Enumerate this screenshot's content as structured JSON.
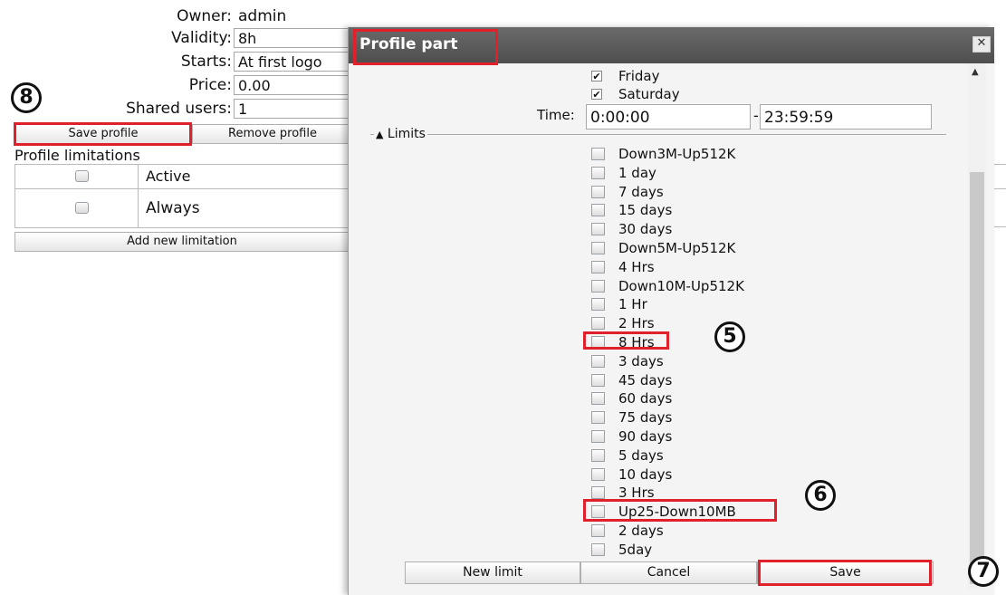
{
  "form": {
    "owner_label": "Owner:",
    "owner_value": "admin",
    "validity_label": "Validity:",
    "validity_value": "8h",
    "starts_label": "Starts:",
    "starts_value": "At first logo",
    "price_label": "Price:",
    "price_value": "0.00",
    "shared_label": "Shared users:",
    "shared_value": "1"
  },
  "actions": {
    "save_profile": "Save profile",
    "remove_profile": "Remove profile"
  },
  "limitations": {
    "title": "Profile limitations",
    "rows": [
      "Active",
      "Always"
    ],
    "add_new": "Add new limitation"
  },
  "dialog": {
    "title": "Profile part",
    "close": "✕",
    "days": [
      "Friday",
      "Saturday"
    ],
    "time_label": "Time:",
    "time_from": "0:00:00",
    "time_sep": "-",
    "time_to": "23:59:59",
    "limits_legend": "Limits",
    "limits": [
      "Down3M-Up512K",
      "1 day",
      "7 days",
      "15 days",
      "30 days",
      "Down5M-Up512K",
      "4 Hrs",
      "Down10M-Up512K",
      "1 Hr",
      "2 Hrs",
      "8 Hrs",
      "3 days",
      "45 days",
      "60 days",
      "75 days",
      "90 days",
      "5 days",
      "10 days",
      "3 Hrs",
      "Up25-Down10MB",
      "2 days",
      "5day"
    ],
    "buttons": {
      "new_limit": "New limit",
      "cancel": "Cancel",
      "save": "Save"
    }
  },
  "markers": {
    "m5": "5",
    "m6": "6",
    "m7": "7",
    "m8": "8"
  },
  "colors": {
    "highlight": "#e0202a",
    "title_bar": "#5a5a5a"
  }
}
